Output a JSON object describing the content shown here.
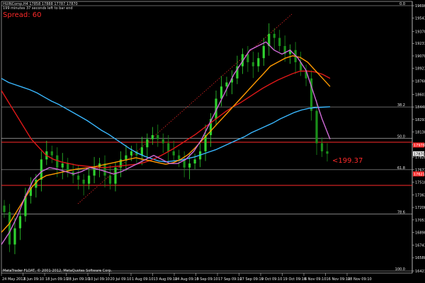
{
  "header": {
    "symbol_line": "HUINComp,H4 17858 17888 17787 17870",
    "timer_line": "199 minutes 37 seconds left to bar end",
    "spread": "Spread: 60"
  },
  "footer": {
    "copyright": "MetaTrader FLOAT, © 2001-2012, MetaQuotes Software Corp."
  },
  "annotation": {
    "label": "<199.37"
  },
  "fib_labels": [
    "0.0",
    "38.2",
    "50.0",
    "61.8",
    "78.6",
    "100.0"
  ],
  "colors": {
    "background": "#000000",
    "bull_candle": "#2fd12f",
    "bear_candle": "#1a8f1a",
    "ma_blue": "#3ab8ff",
    "ma_red": "#e01818",
    "ma_orange": "#ff9a00",
    "ma_violet": "#d06ad8",
    "fib_line": "#c8c8c8",
    "price_line_red": "#ff2a2a"
  },
  "chart_data": {
    "type": "candlestick",
    "y_axis_ticks": [
      "19698",
      "19543",
      "19378",
      "19233",
      "19078",
      "18923",
      "18768",
      "18603",
      "18448",
      "18293",
      "18138",
      "17983",
      "17828",
      "17673",
      "17518",
      "17363",
      "17208",
      "17053",
      "16898",
      "16743",
      "16588",
      "16423"
    ],
    "x_axis_ticks": [
      "24 May 2012",
      "6 Jun 09:10",
      "18 Jun 09:10",
      "28 Jun 09:10",
      "10 Jul 09:10",
      "20 Jul 09:10",
      "1 Aug 09:10",
      "13 Aug 09:10",
      "24 Aug 09:10",
      "5 Sep 09:10",
      "17 Sep 09:10",
      "27 Sep 09:10",
      "9 Oct 09:10",
      "19 Oct 09:10",
      "6 Nov 09:10",
      "16 Nov 09:10",
      "28 Nov 09:10"
    ],
    "price_tags": [
      {
        "label": "17978",
        "color": "#ff2a2a"
      },
      {
        "label": "17870",
        "color": "#e8e8e8"
      },
      {
        "label": "17621",
        "color": "#ff2a2a"
      }
    ],
    "fib_levels": [
      {
        "label": "0.0",
        "price": 19698
      },
      {
        "label": "38.2",
        "price": 18448
      },
      {
        "label": "50.0",
        "price": 18060
      },
      {
        "label": "61.8",
        "price": 17673
      },
      {
        "label": "78.6",
        "price": 17124
      },
      {
        "label": "100.0",
        "price": 16423
      }
    ],
    "series": [
      {
        "kind": "close",
        "values": [
          17150,
          16750,
          16950,
          17100,
          17350,
          17450,
          17550,
          17800,
          17900,
          17850,
          17700,
          17750,
          17650,
          17600,
          17550,
          17500,
          17600,
          17700,
          17750,
          17600,
          17500,
          17700,
          17800,
          17850,
          17900,
          17850,
          17950,
          18050,
          18100,
          18050,
          18000,
          17900,
          17850,
          17800,
          17700,
          17750,
          17800,
          17900,
          18100,
          18300,
          18550,
          18700,
          18750,
          18800,
          18950,
          19100,
          19000,
          18950,
          19050,
          19200,
          19350,
          19300,
          19200,
          19100,
          19150,
          19000,
          18900,
          18800,
          18400,
          18000,
          17900,
          17870
        ]
      },
      {
        "kind": "ma",
        "color": "#3ab8ff",
        "values": [
          18800,
          18750,
          18720,
          18690,
          18660,
          18620,
          18570,
          18520,
          18480,
          18430,
          18380,
          18330,
          18280,
          18220,
          18160,
          18110,
          18050,
          17990,
          17930,
          17880,
          17840,
          17810,
          17780,
          17770,
          17780,
          17790,
          17810,
          17830,
          17860,
          17890,
          17920,
          17960,
          18000,
          18040,
          18080,
          18130,
          18170,
          18210,
          18250,
          18300,
          18340,
          18380,
          18410,
          18430,
          18440,
          18445,
          18450
        ]
      },
      {
        "kind": "ma",
        "color": "#e01818",
        "values": [
          18650,
          18500,
          18350,
          18200,
          18050,
          17950,
          17850,
          17800,
          17770,
          17750,
          17730,
          17720,
          17710,
          17700,
          17700,
          17710,
          17720,
          17730,
          17740,
          17760,
          17790,
          17830,
          17880,
          17930,
          17990,
          18050,
          18110,
          18180,
          18250,
          18320,
          18390,
          18450,
          18500,
          18560,
          18620,
          18680,
          18730,
          18780,
          18820,
          18860,
          18890,
          18890,
          18880,
          18850,
          18800
        ]
      },
      {
        "kind": "ma",
        "color": "#ff9a00",
        "values": [
          16900,
          17000,
          17150,
          17300,
          17450,
          17550,
          17600,
          17620,
          17640,
          17660,
          17680,
          17690,
          17700,
          17720,
          17740,
          17760,
          17780,
          17800,
          17820,
          17800,
          17780,
          17760,
          17740,
          17760,
          17800,
          17860,
          17950,
          18050,
          18150,
          18250,
          18350,
          18450,
          18550,
          18650,
          18750,
          18850,
          18950,
          19000,
          19050,
          19080,
          19060,
          19000,
          18900,
          18800,
          18700
        ]
      },
      {
        "kind": "ma",
        "color": "#d06ad8",
        "values": [
          16750,
          16900,
          17100,
          17350,
          17550,
          17650,
          17700,
          17680,
          17650,
          17620,
          17650,
          17700,
          17680,
          17650,
          17620,
          17650,
          17700,
          17750,
          17800,
          17850,
          17800,
          17750,
          17750,
          17800,
          17900,
          18050,
          18250,
          18450,
          18650,
          18850,
          19000,
          19150,
          19200,
          19250,
          19150,
          19100,
          19150,
          19050,
          18900,
          18600,
          18300,
          18050
        ]
      }
    ],
    "ylim": [
      16423,
      19698
    ],
    "grid": false
  }
}
